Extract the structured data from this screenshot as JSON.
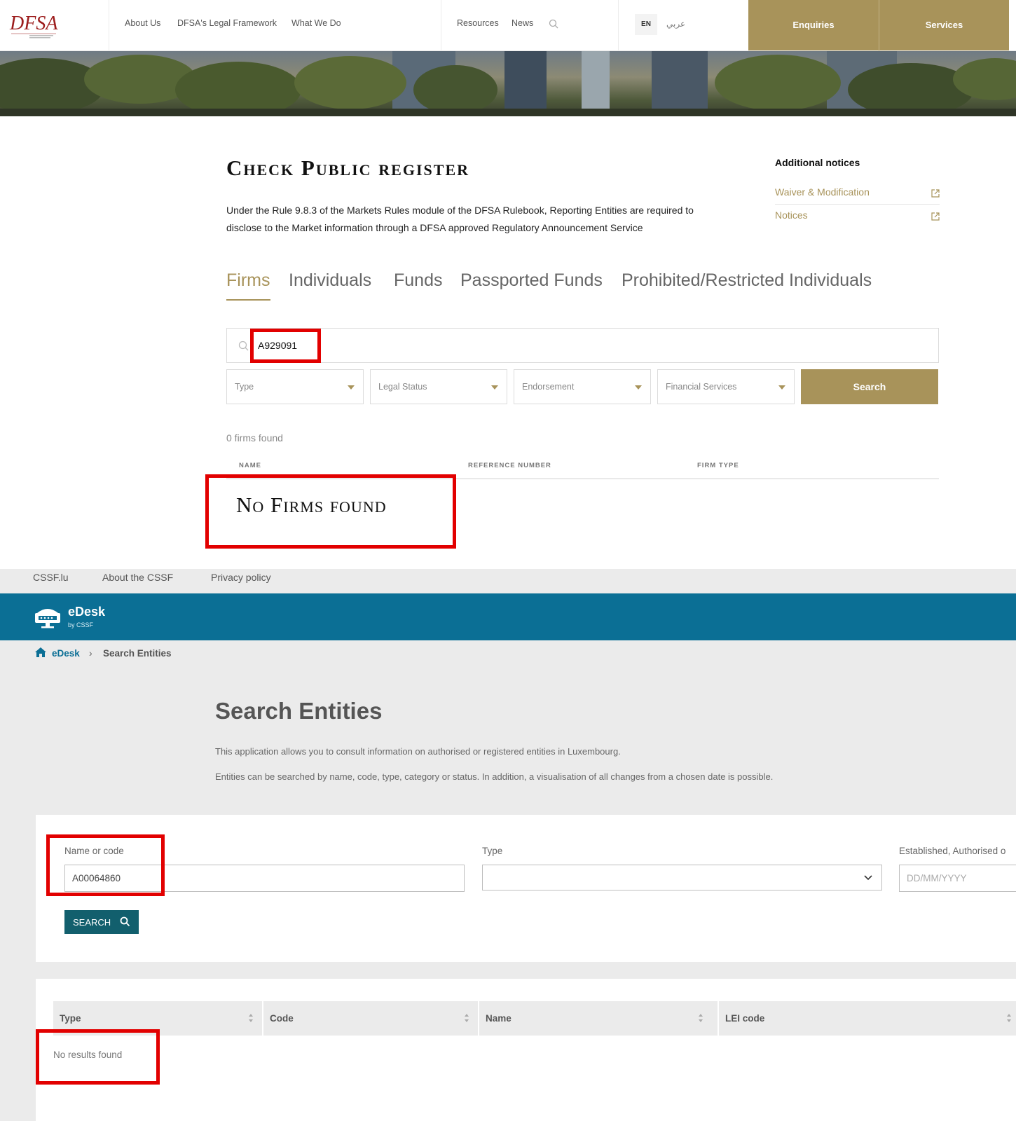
{
  "dfsa": {
    "logo_text": "DFSA",
    "nav": {
      "links": [
        "About Us",
        "DFSA's Legal Framework",
        "What We Do"
      ],
      "links_right": [
        "Resources",
        "News"
      ],
      "lang_en": "EN",
      "lang_ar": "عربي",
      "enquiries": "Enquiries",
      "services": "Services"
    },
    "title": "Check Public register",
    "intro": "Under the Rule 9.8.3 of the Markets Rules module of the DFSA Rulebook, Reporting Entities are required to disclose to the Market information through a DFSA approved Regulatory Announcement Service",
    "additional_notices": {
      "title": "Additional notices",
      "links": [
        "Waiver & Modification",
        "Notices"
      ]
    },
    "tabs": [
      "Firms",
      "Individuals",
      "Funds",
      "Passported Funds",
      "Prohibited/Restricted Individuals"
    ],
    "active_tab": "Firms",
    "search_value": "A929091",
    "filters": [
      "Type",
      "Legal Status",
      "Endorsement",
      "Financial Services"
    ],
    "search_button": "Search",
    "results_count": "0 firms found",
    "columns": [
      "NAME",
      "REFERENCE NUMBER",
      "FIRM TYPE"
    ],
    "empty_message": "No Firms found",
    "accent_color": "#a8935a",
    "highlight_color": "#e20000"
  },
  "cssf": {
    "top_links": [
      "CSSF.lu",
      "About the CSSF",
      "Privacy policy"
    ],
    "app_name": "eDesk",
    "app_sub": "by CSSF",
    "breadcrumb": {
      "link": "eDesk",
      "current": "Search Entities"
    },
    "title": "Search Entities",
    "text_1": "This application allows you to consult information on authorised or registered entities in Luxembourg.",
    "text_2": "Entities can be searched by name, code, type, category or status. In addition, a visualisation of all changes from a chosen date is possible.",
    "form": {
      "name_label": "Name or code",
      "name_value": "A00064860",
      "type_label": "Type",
      "date_label": "Established, Authorised o",
      "date_placeholder": "DD/MM/YYYY",
      "search_button": "SEARCH"
    },
    "table": {
      "columns": [
        "Type",
        "Code",
        "Name",
        "LEI code"
      ],
      "empty_message": "No results found"
    },
    "brand_color": "#0b6f95",
    "button_color": "#125f6d"
  }
}
